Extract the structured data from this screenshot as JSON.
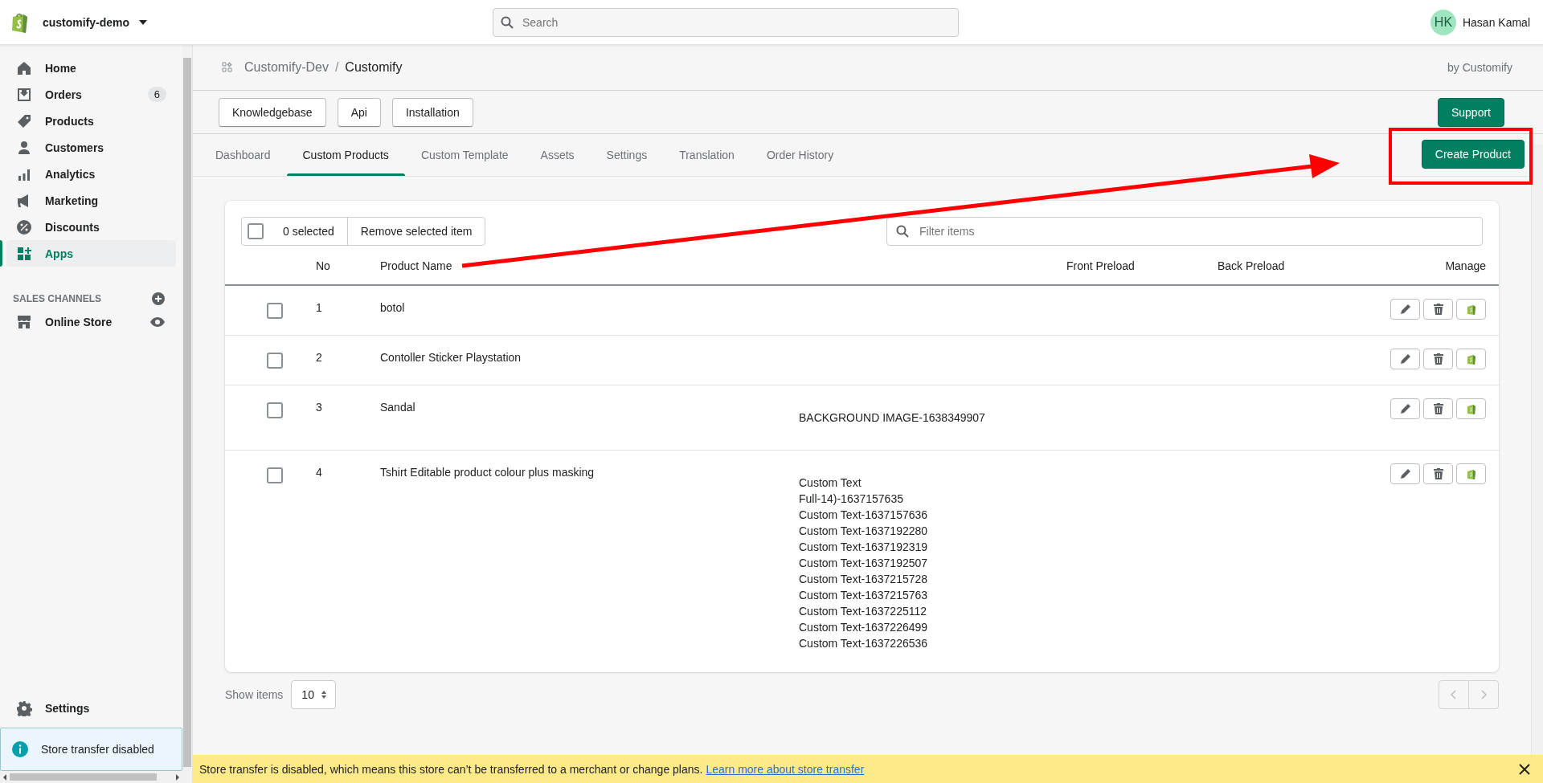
{
  "topbar": {
    "store_name": "customify-demo",
    "search": {
      "placeholder": "Search"
    },
    "user": {
      "initials": "HK",
      "name": "Hasan Kamal"
    }
  },
  "sidebar": {
    "items": [
      {
        "label": "Home",
        "selected": false
      },
      {
        "label": "Orders",
        "badge": "6",
        "selected": false
      },
      {
        "label": "Products",
        "selected": false
      },
      {
        "label": "Customers",
        "selected": false
      },
      {
        "label": "Analytics",
        "selected": false
      },
      {
        "label": "Marketing",
        "selected": false
      },
      {
        "label": "Discounts",
        "selected": false
      },
      {
        "label": "Apps",
        "selected": true
      }
    ],
    "sales_channels": {
      "heading": "SALES CHANNELS",
      "items": [
        {
          "label": "Online Store"
        }
      ]
    },
    "settings": "Settings",
    "notice": "Store transfer disabled"
  },
  "app_header": {
    "breadcrumb_parent": "Customify-Dev",
    "separator": "/",
    "breadcrumb_current": "Customify",
    "byline": "by Customify"
  },
  "buttons": [
    "Knowledgebase",
    "Api",
    "Installation"
  ],
  "support_button": "Support",
  "tabs": [
    {
      "label": "Dashboard",
      "selected": false
    },
    {
      "label": "Custom Products",
      "selected": true
    },
    {
      "label": "Custom Template",
      "selected": false
    },
    {
      "label": "Assets",
      "selected": false
    },
    {
      "label": "Settings",
      "selected": false
    },
    {
      "label": "Translation",
      "selected": false
    },
    {
      "label": "Order History",
      "selected": false
    }
  ],
  "create_button": "Create Product",
  "table": {
    "select_all": {
      "checked": false,
      "label": "0 selected"
    },
    "remove_button": "Remove selected item",
    "filter": {
      "placeholder": "Filter items"
    },
    "columns": {
      "no": "No",
      "product_name": "Product Name",
      "front_preload": "Front Preload",
      "back_preload": "Back Preload",
      "manage": "Manage"
    },
    "rows": [
      {
        "checked": false,
        "no": "1",
        "product_name": "botol"
      },
      {
        "checked": false,
        "no": "2",
        "product_name": "Contoller Sticker Playstation"
      },
      {
        "checked": false,
        "no": "3",
        "product_name": "Sandal",
        "column_3": [
          "BACKGROUND IMAGE-1638349907"
        ]
      },
      {
        "checked": false,
        "no": "4",
        "product_name": "Tshirt Editable product colour plus masking",
        "column_3": [
          "Custom Text",
          "Full-14)-1637157635",
          "Custom Text-1637157636",
          "Custom Text-1637192280",
          "Custom Text-1637192319",
          "Custom Text-1637192507",
          "Custom Text-1637215728",
          "Custom Text-1637215763",
          "Custom Text-1637225112",
          "Custom Text-1637226499",
          "Custom Text-1637226536"
        ]
      }
    ]
  },
  "show_items": {
    "label": "Show items",
    "value": "10"
  },
  "banner": {
    "text": "Store transfer is disabled, which means this store can’t be transferred to a merchant or change plans.",
    "link": "Learn more about store transfer"
  }
}
